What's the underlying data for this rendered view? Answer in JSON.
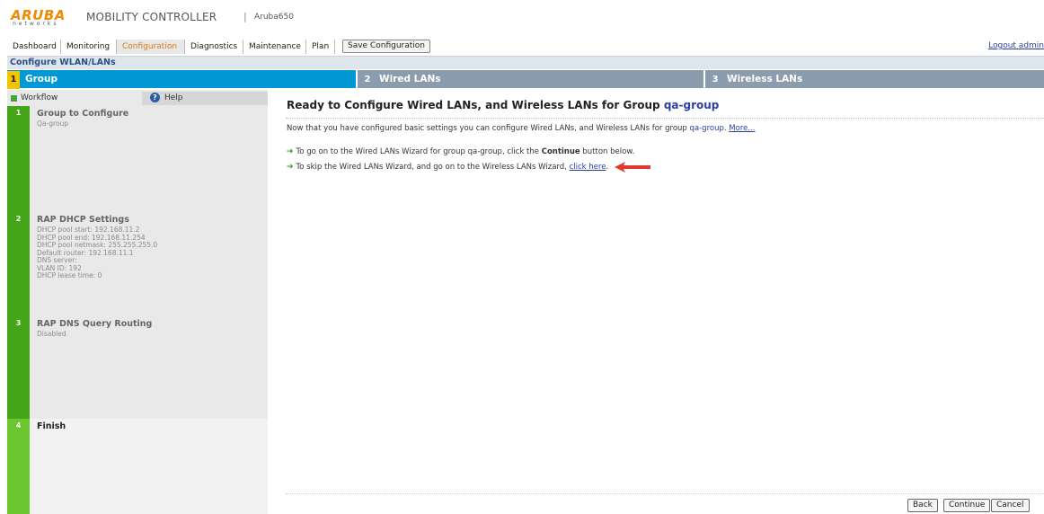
{
  "brand": {
    "logo_text": "ARUBA",
    "logo_sub": "networks",
    "title": "MOBILITY CONTROLLER",
    "separator": "|",
    "host": "Aruba650"
  },
  "nav": {
    "tabs": [
      "Dashboard",
      "Monitoring",
      "Configuration",
      "Diagnostics",
      "Maintenance",
      "Plan"
    ],
    "active": "Configuration",
    "save_label": "Save Configuration",
    "logout_label": "Logout admin"
  },
  "section_title": "Configure WLAN/LANs",
  "steps": [
    {
      "num": "1",
      "label": "Group"
    },
    {
      "num": "2",
      "label": "Wired LANs"
    },
    {
      "num": "3",
      "label": "Wireless LANs"
    }
  ],
  "workflow": {
    "tab_label": "Workflow",
    "help_label": "Help",
    "help_icon": "question-icon",
    "items": [
      {
        "num": "1",
        "title": "Group to Configure",
        "lines": [
          "Qa-group"
        ]
      },
      {
        "num": "2",
        "title": "RAP DHCP Settings",
        "lines": [
          "DHCP pool start: 192.168.11.2",
          "DHCP pool end: 192.168.11.254",
          "DHCP pool netmask: 255.255.255.0",
          "Default router: 192.168.11.1",
          "DNS server:",
          "VLAN ID: 192",
          "DHCP lease time: 0"
        ]
      },
      {
        "num": "3",
        "title": "RAP DNS Query Routing",
        "lines": [
          "Disabled"
        ]
      },
      {
        "num": "4",
        "title": "Finish",
        "lines": []
      }
    ]
  },
  "main": {
    "heading_prefix": "Ready to Configure Wired LANs, and Wireless LANs for Group ",
    "heading_group": "qa-group",
    "intro_prefix": "Now that you have configured basic settings you can configure Wired LANs, and Wireless LANs for group ",
    "intro_group": "qa-group",
    "intro_dot": ". ",
    "more_link": "More...",
    "bullet1_prefix": "To go on to the Wired LANs Wizard for group qa-group, click the ",
    "bullet1_bold": "Continue",
    "bullet1_suffix": " button below.",
    "bullet2_prefix": "To skip the Wired LANs Wizard, and go on to the Wireless LANs Wizard, ",
    "bullet2_link": "click here",
    "bullet2_suffix": "."
  },
  "buttons": {
    "back": "Back",
    "continue": "Continue",
    "cancel": "Cancel"
  },
  "colors": {
    "brand_orange": "#f08a00",
    "step_active": "#0099d6",
    "step_inactive": "#8a9cad",
    "workflow_green": "#44a519",
    "link_blue": "#2a3fa8",
    "annotation_red": "#e03a2f"
  }
}
